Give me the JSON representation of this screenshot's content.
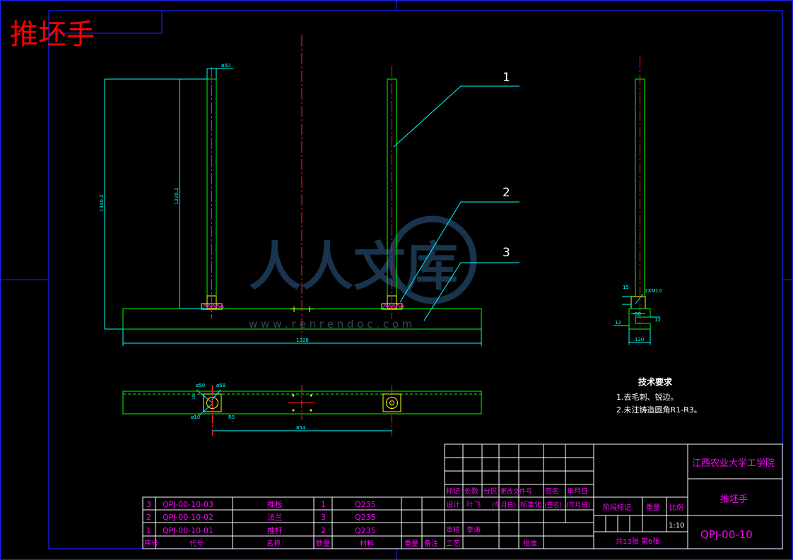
{
  "title_stamp": "推坯手",
  "balloons": [
    "1",
    "2",
    "3"
  ],
  "dims": {
    "d50_top": "ø50",
    "h_total": "1340.2",
    "h_post": "1220.2",
    "len_total": "1928",
    "d50_plan": "ø50",
    "d58_plan": "ø58",
    "d10_plan": "ø10",
    "r5": "R5",
    "sp854": "854",
    "side_15": "15",
    "side_bolt": "2XM10",
    "side_80": "80",
    "side_12a": "12",
    "side_12b": "12",
    "side_120": "120",
    "d10_small": "10"
  },
  "watermark": {
    "text": "人人文库",
    "url": "w w w . r e n r e n d o c . c o m"
  },
  "tech": {
    "title": "技术要求",
    "items": [
      "1.去毛刺、锐边。",
      "2.未注铸造圆角R1-R3。"
    ]
  },
  "bom": {
    "header": [
      "序号",
      "代号",
      "名称",
      "数量",
      "材料",
      "重量",
      "备注"
    ],
    "rows": [
      {
        "no": "3",
        "code": "QPJ-00-10-03",
        "name": "推板",
        "qty": "1",
        "mat": "Q235"
      },
      {
        "no": "2",
        "code": "QPJ-00-10-02",
        "name": "法兰",
        "qty": "3",
        "mat": "Q235"
      },
      {
        "no": "1",
        "code": "QPJ-00-10-01",
        "name": "推杆",
        "qty": "2",
        "mat": "Q235"
      }
    ]
  },
  "titleblock": {
    "rev_header": [
      "标记",
      "处数",
      "分区",
      "更改文件号",
      "签名",
      "年月日"
    ],
    "design_label": "设计",
    "designer": "叶飞",
    "date_ph": "(年月日)",
    "std_label": "标准化",
    "sign_ph": "(签名)",
    "date_ph2": "(年月日)",
    "check_label": "审核",
    "checker": "李涛",
    "craft_label": "工艺",
    "approve_label": "批准",
    "stage_label": "阶段标记",
    "weight_label": "重量",
    "scale_label": "比例",
    "scale": "1:10",
    "sheets": "共13张 第6张",
    "school": "江西农业大学工学院",
    "part_name": "推坯手",
    "drawing_no": "QPJ-00-10"
  }
}
